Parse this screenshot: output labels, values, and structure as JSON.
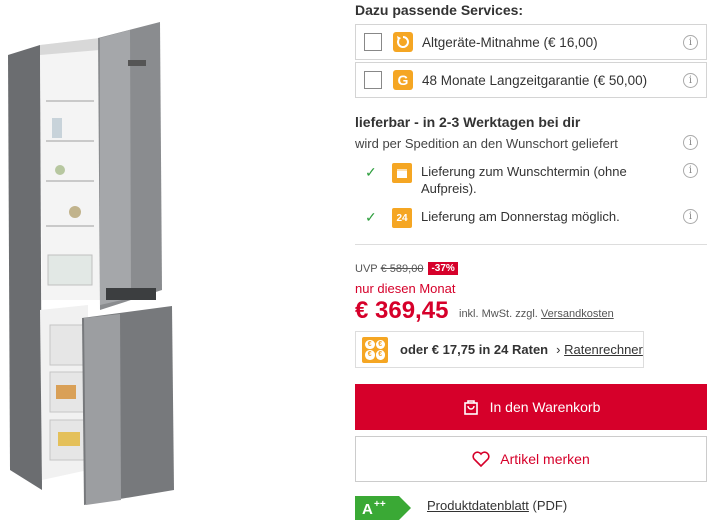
{
  "services": {
    "title": "Dazu passende Services:",
    "items": [
      {
        "label": "Altgeräte-Mitnahme (€ 16,00)",
        "icon": "recycle-icon"
      },
      {
        "label": "48 Monate Langzeitgarantie (€ 50,00)",
        "icon": "guarantee-icon",
        "icon_text": "G"
      }
    ]
  },
  "delivery": {
    "status": "lieferbar - in 2-3 Werktagen bei dir",
    "method": "wird per Spedition an den Wunschort geliefert",
    "items": [
      {
        "text": "Lieferung zum Wunschtermin (ohne Aufpreis).",
        "icon": "calendar-icon"
      },
      {
        "text": "Lieferung am Donnerstag möglich.",
        "icon": "24h-icon",
        "icon_text": "24"
      }
    ]
  },
  "price": {
    "uvp_label": "UVP",
    "uvp_value": "€ 589,00",
    "discount": "-37%",
    "promo": "nur diesen Monat",
    "current": "€ 369,45",
    "tax_note": "inkl. MwSt. zzgl.",
    "shipping_link": "Versandkosten"
  },
  "financing": {
    "text": "oder € 17,75 in 24 Raten",
    "link_arrow": "›",
    "link": "Ratenrechner",
    "icon_symbols": [
      "€",
      "€",
      "€",
      "€"
    ]
  },
  "buttons": {
    "cart": "In den Warenkorb",
    "wishlist": "Artikel merken"
  },
  "energy": {
    "label": "A",
    "sup": "++",
    "color": "#3aa935"
  },
  "datasheet": {
    "link": "Produktdatenblatt",
    "suffix": "(PDF)"
  },
  "colors": {
    "accent": "#d6002a",
    "service_icon": "#f5a623",
    "check": "#2e9e3e"
  }
}
